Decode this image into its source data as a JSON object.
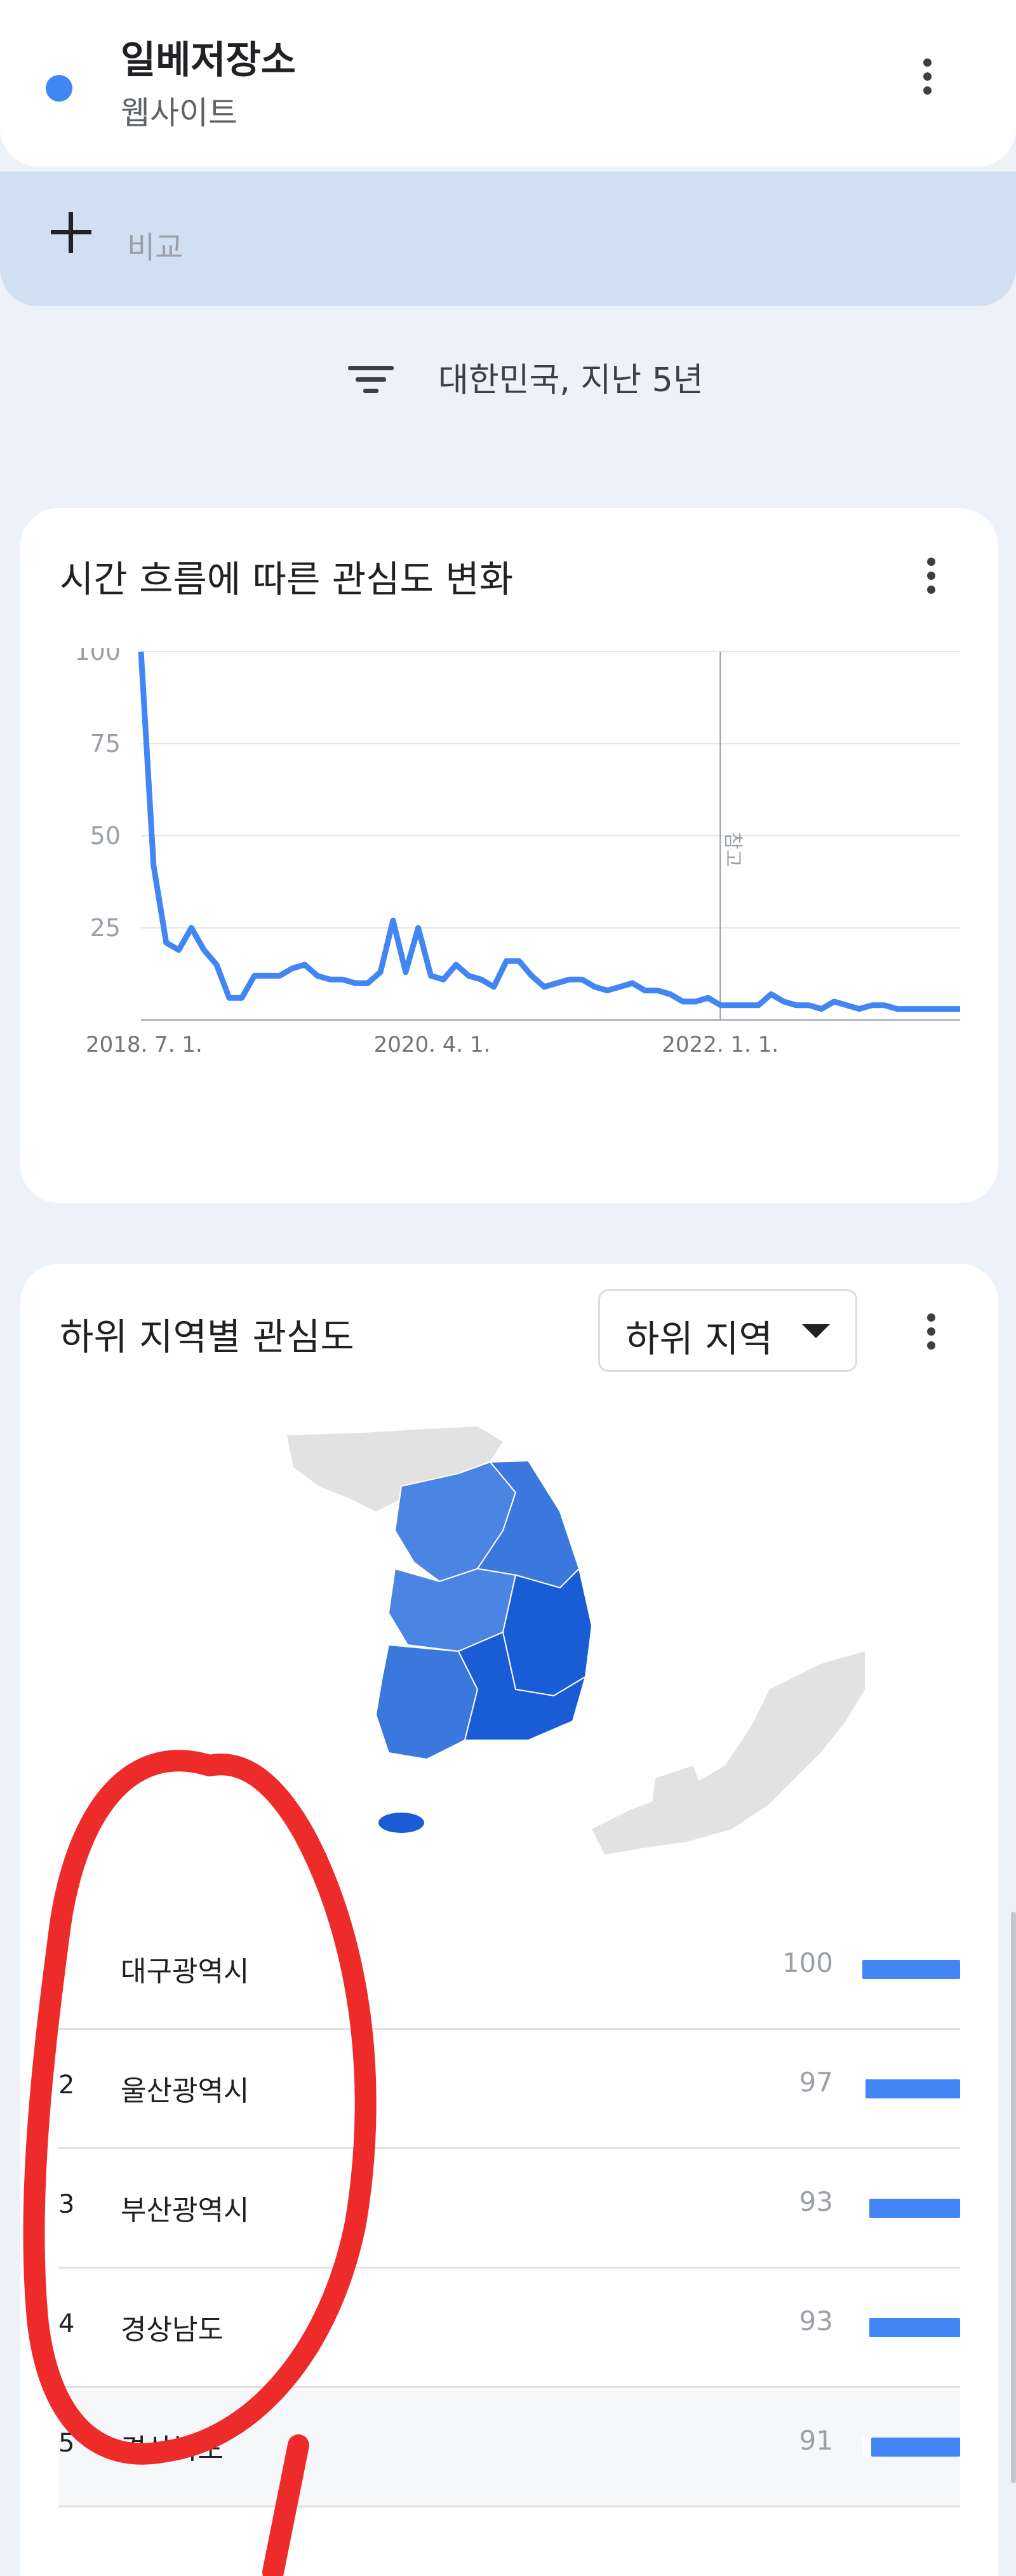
{
  "term": {
    "name": "일베저장소",
    "type": "웹사이트",
    "series_color": "#4285f4"
  },
  "compare": {
    "label": "비교",
    "icon": "plus-icon"
  },
  "filter": {
    "icon": "filter-icon",
    "text": "대한민국, 지난 5년"
  },
  "timeline": {
    "title": "시간 흐름에 따른 관심도 변화",
    "menu_icon": "more-vert-icon",
    "note_label": "참고"
  },
  "chart_data": {
    "type": "line",
    "title": "시간 흐름에 따른 관심도 변화",
    "xlabel": "",
    "ylabel": "",
    "ylim": [
      0,
      100
    ],
    "yticks": [
      25,
      50,
      75,
      100
    ],
    "xtick_labels": [
      "2018. 7. 1.",
      "2020. 4. 1.",
      "2022. 1. 1."
    ],
    "x_range": [
      "2018-06-24",
      "2023-06-18"
    ],
    "note_marker_x": "2022-01-01",
    "grid": true,
    "series": [
      {
        "color": "#4285f4",
        "x": [
          "2018-06-24",
          "2018-07-22",
          "2018-08-19",
          "2018-09-16",
          "2018-10-14",
          "2018-11-11",
          "2018-12-09",
          "2019-01-06",
          "2019-02-03",
          "2019-03-03",
          "2019-03-31",
          "2019-04-28",
          "2019-05-26",
          "2019-06-23",
          "2019-07-21",
          "2019-08-18",
          "2019-09-15",
          "2019-10-13",
          "2019-11-10",
          "2019-12-08",
          "2020-01-05",
          "2020-02-02",
          "2020-03-01",
          "2020-03-29",
          "2020-04-26",
          "2020-05-24",
          "2020-06-21",
          "2020-07-19",
          "2020-08-16",
          "2020-09-13",
          "2020-10-11",
          "2020-11-08",
          "2020-12-06",
          "2021-01-03",
          "2021-01-31",
          "2021-02-28",
          "2021-03-28",
          "2021-04-25",
          "2021-05-23",
          "2021-06-20",
          "2021-07-18",
          "2021-08-15",
          "2021-09-12",
          "2021-10-10",
          "2021-11-07",
          "2021-12-05",
          "2022-01-02",
          "2022-01-30",
          "2022-02-27",
          "2022-03-27",
          "2022-04-24",
          "2022-05-22",
          "2022-06-19",
          "2022-07-17",
          "2022-08-14",
          "2022-09-11",
          "2022-10-09",
          "2022-11-06",
          "2022-12-04",
          "2023-01-01",
          "2023-01-29",
          "2023-02-26",
          "2023-03-26",
          "2023-04-23",
          "2023-05-21",
          "2023-06-18"
        ],
        "values": [
          100,
          42,
          21,
          19,
          25,
          19,
          15,
          6,
          6,
          12,
          12,
          12,
          14,
          15,
          12,
          11,
          11,
          10,
          10,
          13,
          27,
          13,
          25,
          12,
          11,
          15,
          12,
          11,
          9,
          16,
          16,
          12,
          9,
          10,
          11,
          11,
          9,
          8,
          9,
          10,
          8,
          8,
          7,
          5,
          5,
          6,
          4,
          4,
          4,
          4,
          7,
          5,
          4,
          4,
          3,
          5,
          4,
          3,
          4,
          4,
          3,
          3,
          3,
          3,
          3,
          3
        ]
      }
    ]
  },
  "regions": {
    "title": "하위 지역별 관심도",
    "selector_label": "하위 지역",
    "menu_icon": "more-vert-icon",
    "map_colors": {
      "dark": "#1a5bd6",
      "mid": "#3a78dd",
      "light": "#4a85e4",
      "land_gray": "#e2e2e2"
    },
    "items": [
      {
        "rank": "",
        "name": "대구광역시",
        "value": 100
      },
      {
        "rank": "2",
        "name": "울산광역시",
        "value": 97
      },
      {
        "rank": "3",
        "name": "부산광역시",
        "value": 93
      },
      {
        "rank": "4",
        "name": "경상남도",
        "value": 93
      },
      {
        "rank": "5",
        "name": "경상북도",
        "value": 91
      }
    ],
    "bar_color": "#4285f4"
  },
  "annotation_color": "#ee2b2b"
}
